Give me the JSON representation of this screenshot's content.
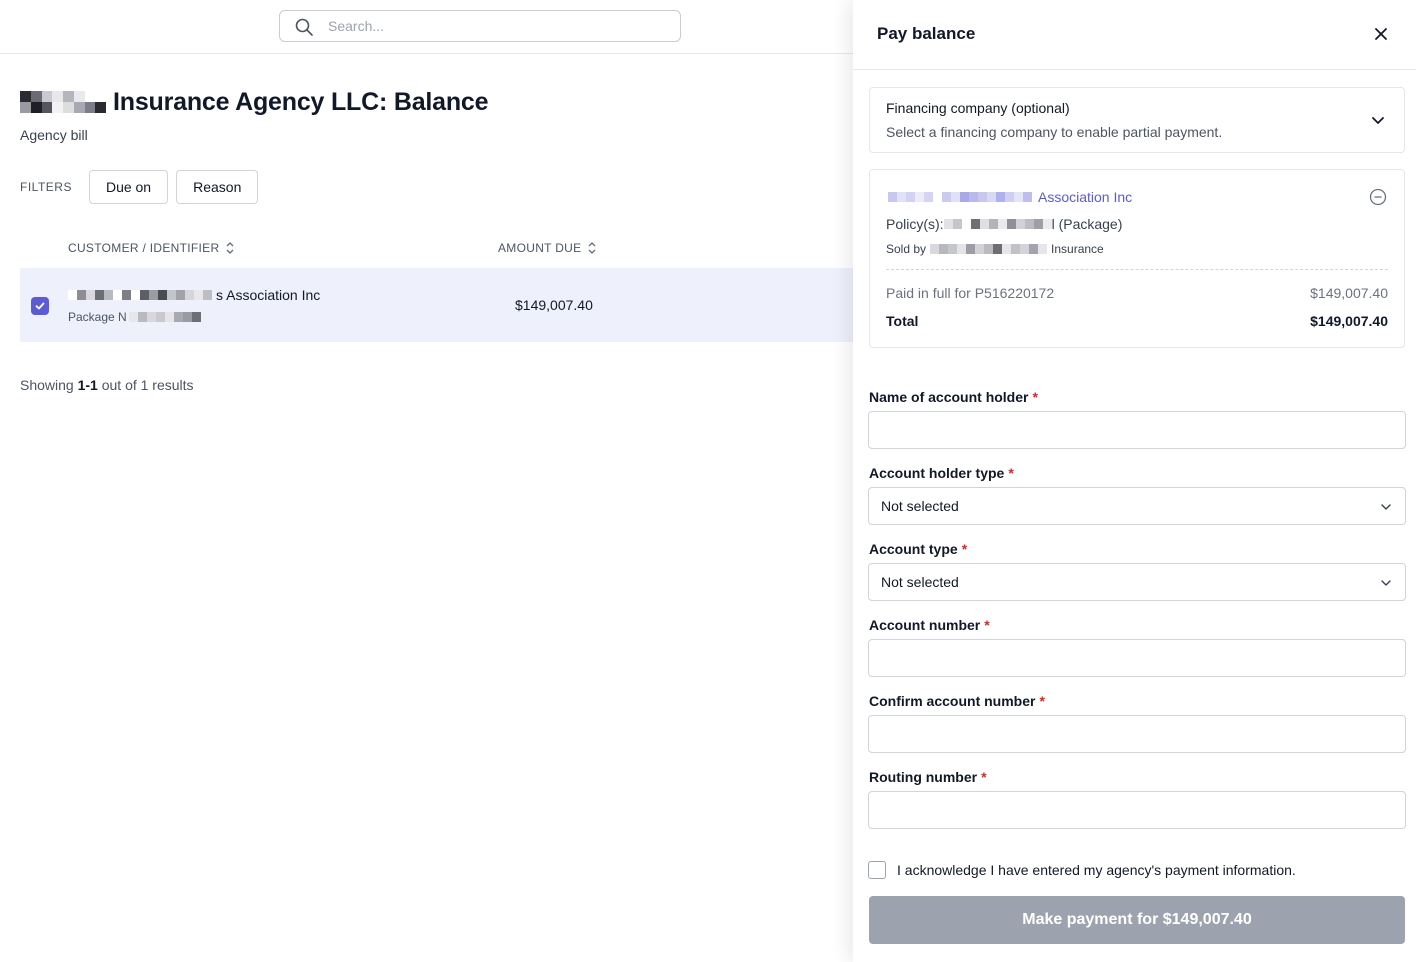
{
  "search": {
    "placeholder": "Search..."
  },
  "page": {
    "title": "Insurance Agency LLC: Balance",
    "subtitle": "Agency bill"
  },
  "filters": {
    "label": "FILTERS",
    "buttons": [
      "Due on",
      "Reason"
    ]
  },
  "table": {
    "columns": [
      "CUSTOMER / IDENTIFIER",
      "AMOUNT DUE"
    ],
    "rows": [
      {
        "customer": "s Association Inc",
        "identifier": "Package N",
        "amount": "$149,007.40",
        "selected": true
      }
    ]
  },
  "pagination": {
    "prefix": "Showing ",
    "range": "1-1",
    "suffix": " out of 1 results"
  },
  "panel": {
    "title": "Pay balance",
    "financing": {
      "label": "Financing company (optional)",
      "hint": "Select a financing company to enable partial payment."
    },
    "summary": {
      "customer": "Association Inc",
      "policy_prefix": "Policy(s):",
      "policy_suffix": "l (Package)",
      "sold_prefix": "Sold by",
      "sold_suffix": "Insurance",
      "line_label": "Paid in full for P516220172",
      "line_value": "$149,007.40",
      "total_label": "Total",
      "total_value": "$149,007.40"
    },
    "fields": {
      "holder_name": {
        "label": "Name of account holder",
        "value": ""
      },
      "holder_type": {
        "label": "Account holder type",
        "value": "Not selected"
      },
      "account_type": {
        "label": "Account type",
        "value": "Not selected"
      },
      "account_number": {
        "label": "Account number",
        "value": ""
      },
      "confirm_number": {
        "label": "Confirm account number",
        "value": ""
      },
      "routing_number": {
        "label": "Routing number",
        "value": ""
      }
    },
    "required_mark": "*",
    "acknowledge": "I acknowledge I have entered my agency's payment information.",
    "pay_button": "Make payment for $149,007.40"
  },
  "colors": {
    "accent": "#5b5bd6",
    "selected_row": "#eef0fb",
    "required": "#dc2626",
    "disabled_button": "#9ca3af"
  },
  "icons": {
    "search": "search-icon",
    "sort": "sort-icon",
    "close": "close-icon",
    "chevron": "chevron-down-icon",
    "remove": "minus-circle-icon",
    "check": "check-icon"
  }
}
